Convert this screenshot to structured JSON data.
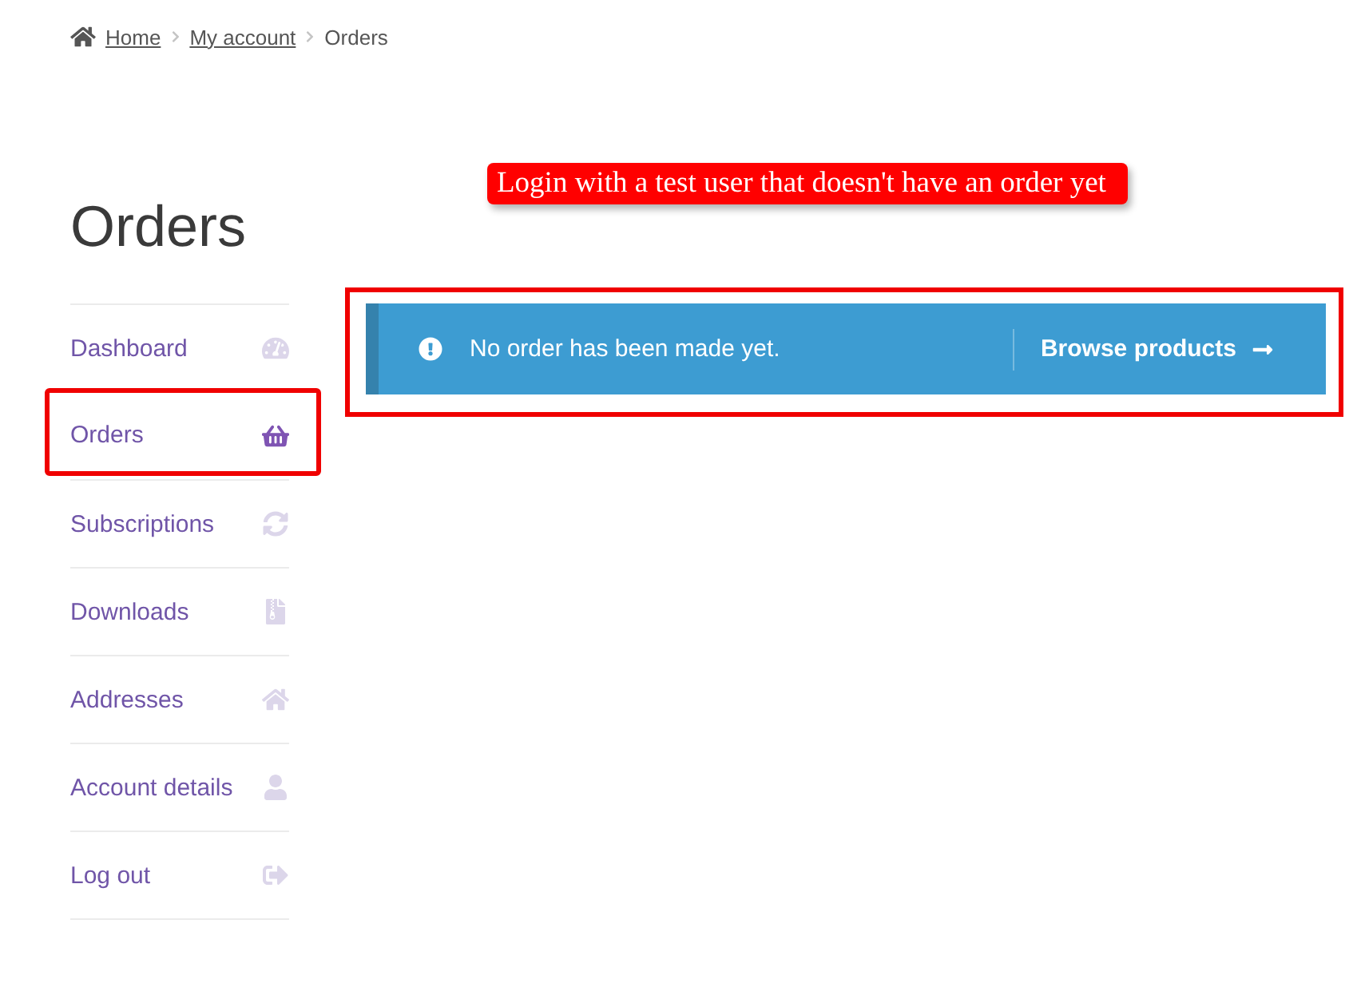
{
  "breadcrumb": [
    {
      "label": "Home",
      "link": true
    },
    {
      "label": "My account",
      "link": true
    },
    {
      "label": "Orders",
      "link": false
    }
  ],
  "callout": {
    "text": "Login with a test user that doesn't have an order yet"
  },
  "heading": "Orders",
  "nav": {
    "items": [
      {
        "label": "Dashboard",
        "selected": false,
        "highlighted": false
      },
      {
        "label": "Orders",
        "selected": true,
        "highlighted": true
      },
      {
        "label": "Subscriptions",
        "selected": false,
        "highlighted": false
      },
      {
        "label": "Downloads",
        "selected": false,
        "highlighted": false
      },
      {
        "label": "Addresses",
        "selected": false,
        "highlighted": false
      },
      {
        "label": "Account details",
        "selected": false,
        "highlighted": false
      },
      {
        "label": "Log out",
        "selected": false,
        "highlighted": false
      }
    ]
  },
  "notice": {
    "message": "No order has been made yet.",
    "button": "Browse products",
    "highlighted": true
  }
}
